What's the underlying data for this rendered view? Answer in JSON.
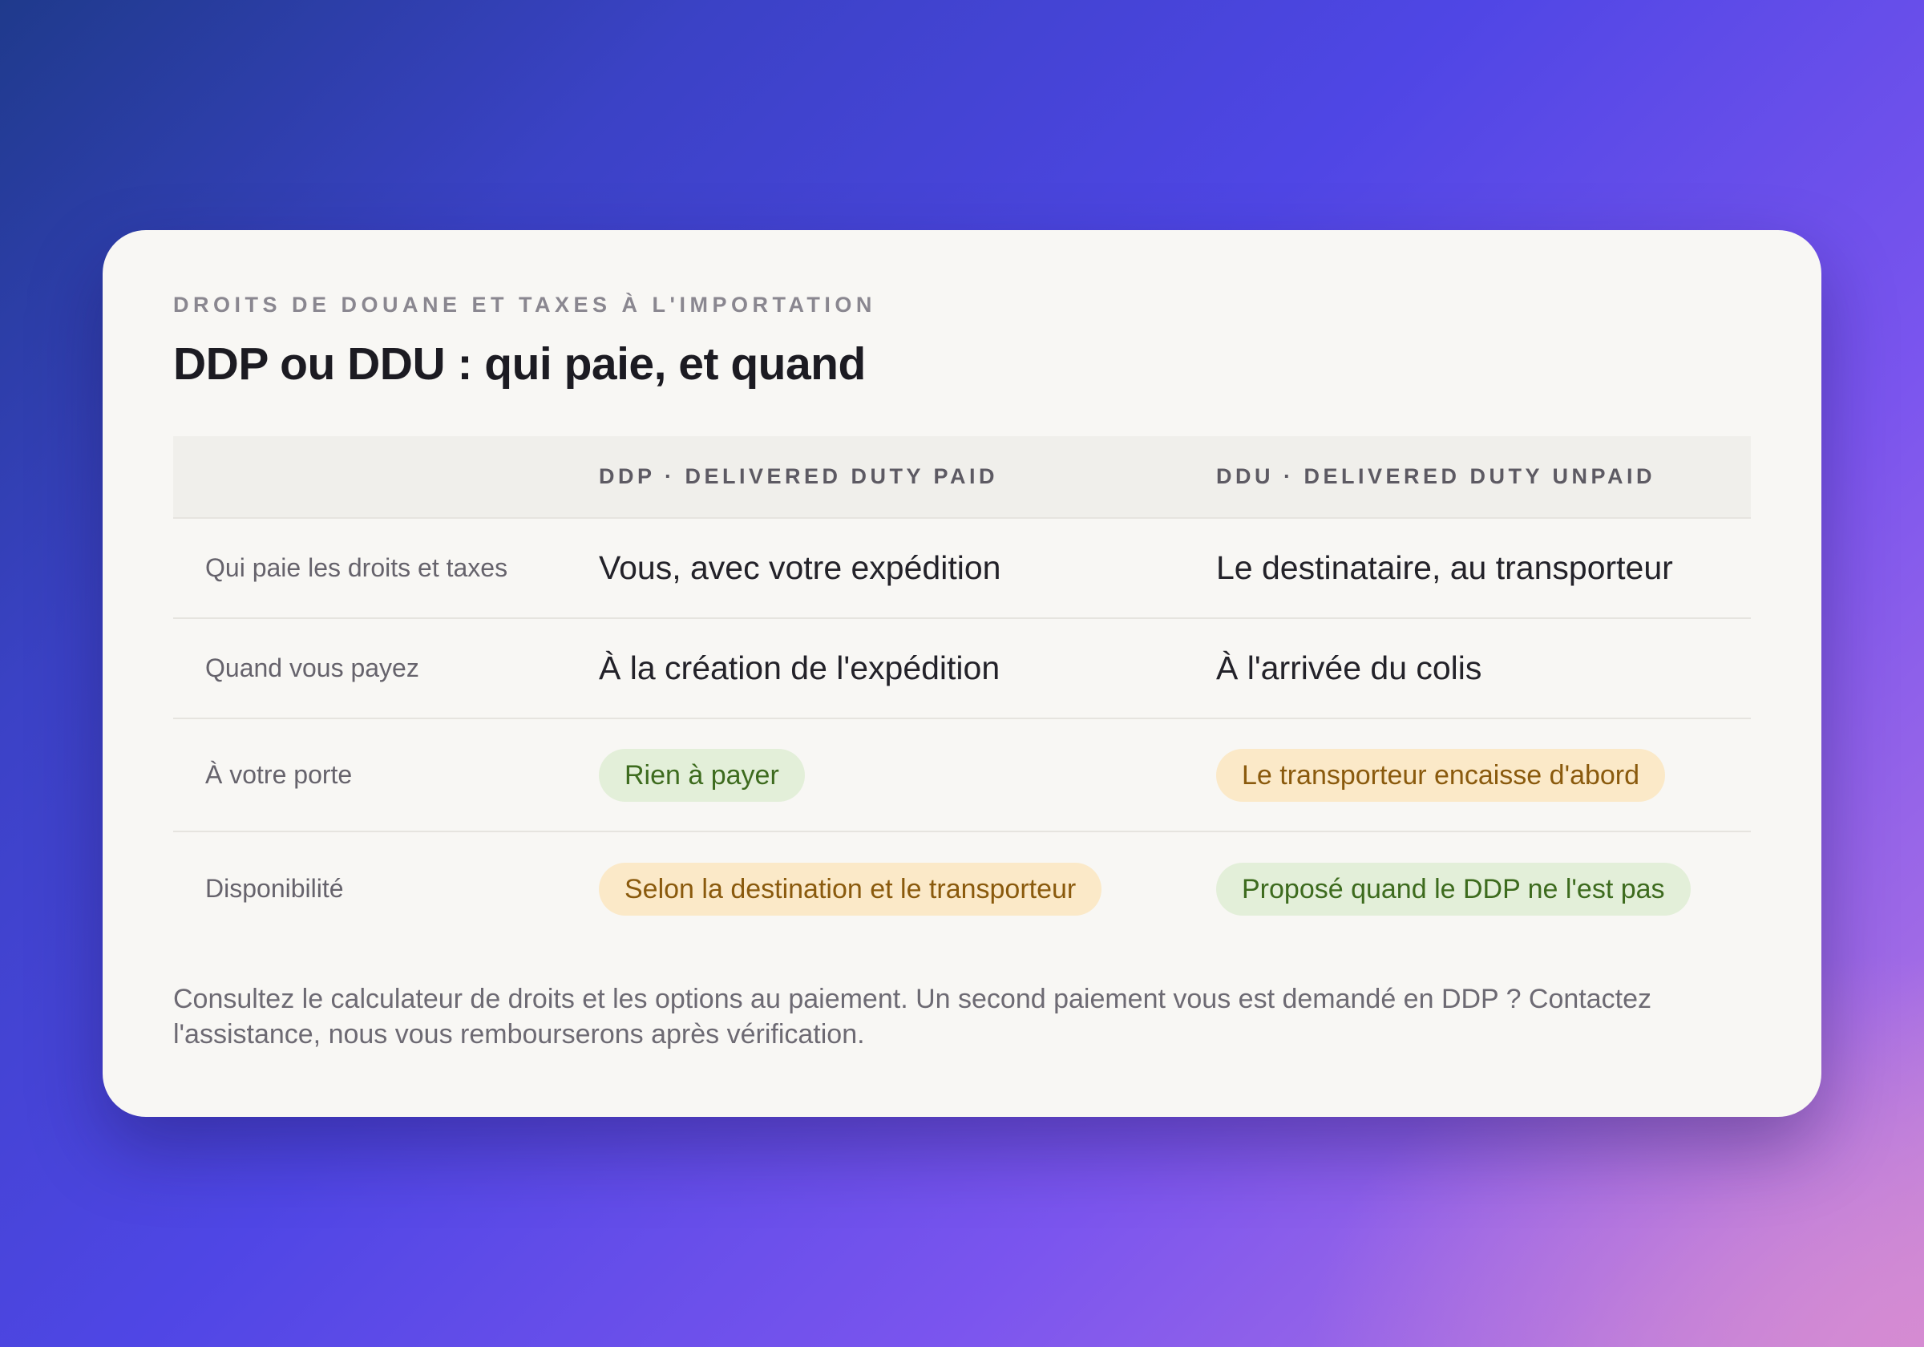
{
  "card": {
    "eyebrow": "DROITS DE DOUANE ET TAXES À L'IMPORTATION",
    "title": "DDP ou DDU : qui paie, et quand"
  },
  "table": {
    "headers": {
      "label": "",
      "ddp": "DDP · DELIVERED DUTY PAID",
      "ddu": "DDU · DELIVERED DUTY UNPAID"
    },
    "rows": [
      {
        "label": "Qui paie les droits et taxes",
        "ddp": {
          "text": "Vous, avec votre expédition"
        },
        "ddu": {
          "text": "Le destinataire, au transporteur"
        }
      },
      {
        "label": "Quand vous payez",
        "ddp": {
          "text": "À la création de l'expédition"
        },
        "ddu": {
          "text": "À l'arrivée du colis"
        }
      },
      {
        "label": "À votre porte",
        "ddp": {
          "text": "Rien à payer",
          "tone": "green"
        },
        "ddu": {
          "text": "Le transporteur encaisse d'abord",
          "tone": "amber"
        }
      },
      {
        "label": "Disponibilité",
        "ddp": {
          "text": "Selon la destination et le transporteur",
          "tone": "amber"
        },
        "ddu": {
          "text": "Proposé quand le DDP ne l'est pas",
          "tone": "green"
        }
      }
    ]
  },
  "footer": {
    "text": "Consultez le calculateur de droits et les options au paiement. Un second paiement vous est demandé en DDP ? Contactez l'assistance, nous vous rembourserons après vérification."
  },
  "colors": {
    "card_background": "#f8f7f4",
    "pill_green_bg": "#e3efd9",
    "pill_green_text": "#3d6b1e",
    "pill_amber_bg": "#fbe9c8",
    "pill_amber_text": "#8a5a0d",
    "title_text": "#1c1b22"
  }
}
